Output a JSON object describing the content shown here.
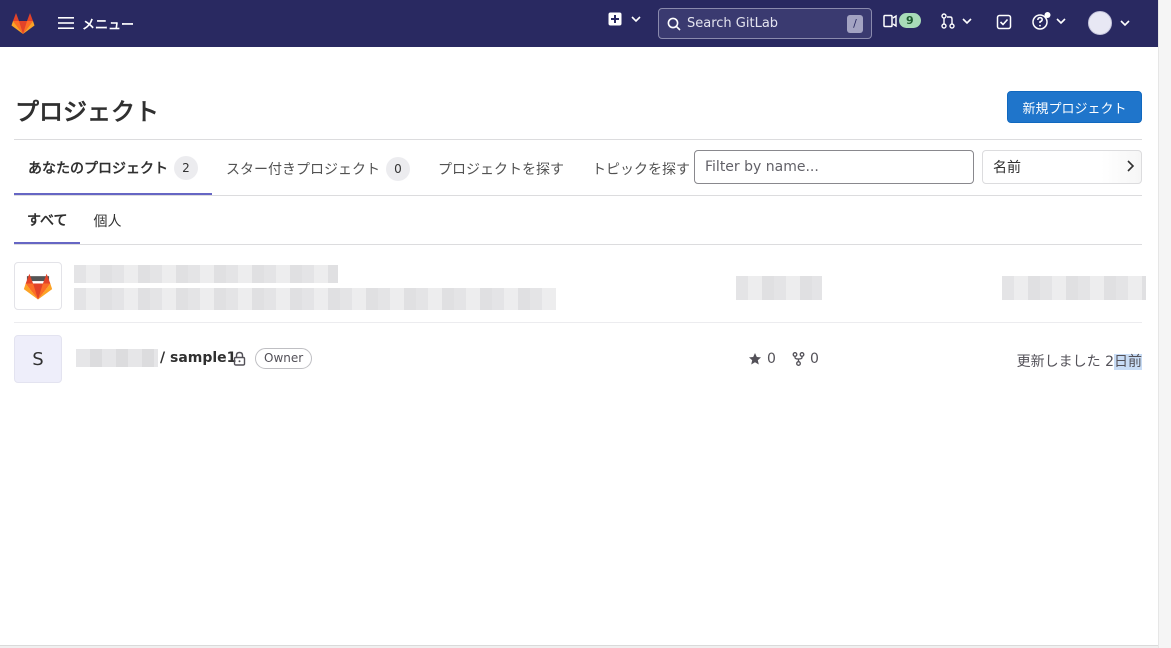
{
  "navbar": {
    "menu_label": "メニュー",
    "search_placeholder": "Search GitLab",
    "search_shortcut": "/",
    "issues_count": "9",
    "colors": {
      "background": "#292961",
      "badge": "#a8dcb8"
    }
  },
  "header": {
    "title": "プロジェクト",
    "new_project_label": "新規プロジェクト"
  },
  "tabs": [
    {
      "label": "あなたのプロジェクト",
      "count": "2"
    },
    {
      "label": "スター付きプロジェクト",
      "count": "0"
    },
    {
      "label": "プロジェクトを探す"
    },
    {
      "label": "トピックを探す"
    }
  ],
  "filter": {
    "placeholder": "Filter by name...",
    "sort_label": "名前"
  },
  "subtabs": [
    {
      "label": "すべて"
    },
    {
      "label": "個人"
    }
  ],
  "projects": [
    {
      "avatar": "gitlab-logo",
      "name": "",
      "redacted": true
    },
    {
      "avatar_letter": "S",
      "name": "/ sample1",
      "visibility": "lock-icon",
      "role": "Owner",
      "stars": "0",
      "forks": "0",
      "updated_prefix": "更新しました 2",
      "updated_suffix": "日前"
    }
  ]
}
